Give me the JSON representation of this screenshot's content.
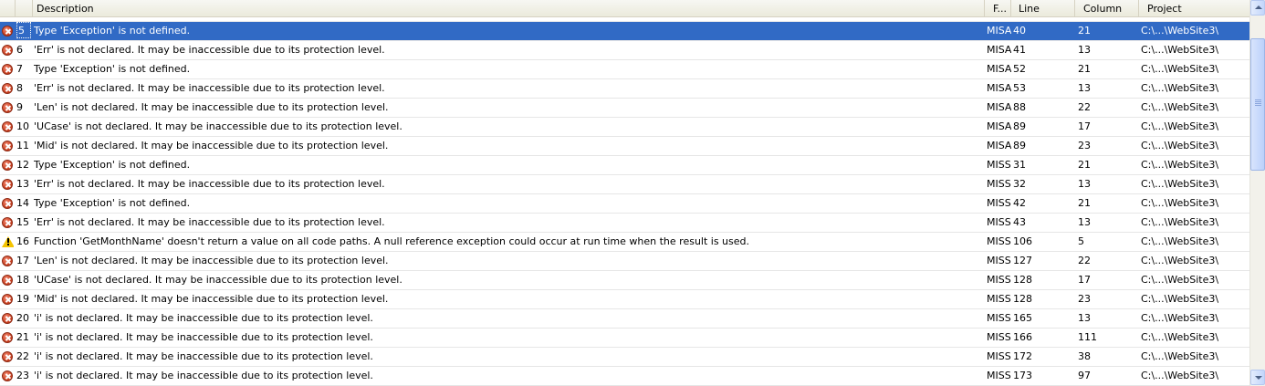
{
  "columns": {
    "description": "Description",
    "file": "F...",
    "line": "Line",
    "column": "Column",
    "project": "Project"
  },
  "rows": [
    {
      "type": "error",
      "num": "5",
      "desc": "Type 'Exception' is not defined.",
      "file": "MISA",
      "line": "40",
      "col": "21",
      "project": "C:\\...\\WebSite3\\",
      "selected": true
    },
    {
      "type": "error",
      "num": "6",
      "desc": "'Err' is not declared. It may be inaccessible due to its protection level.",
      "file": "MISA",
      "line": "41",
      "col": "13",
      "project": "C:\\...\\WebSite3\\"
    },
    {
      "type": "error",
      "num": "7",
      "desc": "Type 'Exception' is not defined.",
      "file": "MISA",
      "line": "52",
      "col": "21",
      "project": "C:\\...\\WebSite3\\"
    },
    {
      "type": "error",
      "num": "8",
      "desc": "'Err' is not declared. It may be inaccessible due to its protection level.",
      "file": "MISA",
      "line": "53",
      "col": "13",
      "project": "C:\\...\\WebSite3\\"
    },
    {
      "type": "error",
      "num": "9",
      "desc": "'Len' is not declared. It may be inaccessible due to its protection level.",
      "file": "MISA",
      "line": "88",
      "col": "22",
      "project": "C:\\...\\WebSite3\\"
    },
    {
      "type": "error",
      "num": "10",
      "desc": "'UCase' is not declared. It may be inaccessible due to its protection level.",
      "file": "MISA",
      "line": "89",
      "col": "17",
      "project": "C:\\...\\WebSite3\\"
    },
    {
      "type": "error",
      "num": "11",
      "desc": "'Mid' is not declared. It may be inaccessible due to its protection level.",
      "file": "MISA",
      "line": "89",
      "col": "23",
      "project": "C:\\...\\WebSite3\\"
    },
    {
      "type": "error",
      "num": "12",
      "desc": "Type 'Exception' is not defined.",
      "file": "MISS",
      "line": "31",
      "col": "21",
      "project": "C:\\...\\WebSite3\\"
    },
    {
      "type": "error",
      "num": "13",
      "desc": "'Err' is not declared. It may be inaccessible due to its protection level.",
      "file": "MISS",
      "line": "32",
      "col": "13",
      "project": "C:\\...\\WebSite3\\"
    },
    {
      "type": "error",
      "num": "14",
      "desc": "Type 'Exception' is not defined.",
      "file": "MISS",
      "line": "42",
      "col": "21",
      "project": "C:\\...\\WebSite3\\"
    },
    {
      "type": "error",
      "num": "15",
      "desc": "'Err' is not declared. It may be inaccessible due to its protection level.",
      "file": "MISS",
      "line": "43",
      "col": "13",
      "project": "C:\\...\\WebSite3\\"
    },
    {
      "type": "warning",
      "num": "16",
      "desc": "Function 'GetMonthName' doesn't return a value on all code paths. A null reference exception could occur at run time when the result is used.",
      "file": "MISS",
      "line": "106",
      "col": "5",
      "project": "C:\\...\\WebSite3\\"
    },
    {
      "type": "error",
      "num": "17",
      "desc": "'Len' is not declared. It may be inaccessible due to its protection level.",
      "file": "MISS",
      "line": "127",
      "col": "22",
      "project": "C:\\...\\WebSite3\\"
    },
    {
      "type": "error",
      "num": "18",
      "desc": "'UCase' is not declared. It may be inaccessible due to its protection level.",
      "file": "MISS",
      "line": "128",
      "col": "17",
      "project": "C:\\...\\WebSite3\\"
    },
    {
      "type": "error",
      "num": "19",
      "desc": "'Mid' is not declared. It may be inaccessible due to its protection level.",
      "file": "MISS",
      "line": "128",
      "col": "23",
      "project": "C:\\...\\WebSite3\\"
    },
    {
      "type": "error",
      "num": "20",
      "desc": "'i' is not declared. It may be inaccessible due to its protection level.",
      "file": "MISS",
      "line": "165",
      "col": "13",
      "project": "C:\\...\\WebSite3\\"
    },
    {
      "type": "error",
      "num": "21",
      "desc": "'i' is not declared. It may be inaccessible due to its protection level.",
      "file": "MISS",
      "line": "166",
      "col": "111",
      "project": "C:\\...\\WebSite3\\"
    },
    {
      "type": "error",
      "num": "22",
      "desc": "'i' is not declared. It may be inaccessible due to its protection level.",
      "file": "MISS",
      "line": "172",
      "col": "38",
      "project": "C:\\...\\WebSite3\\"
    },
    {
      "type": "error",
      "num": "23",
      "desc": "'i' is not declared. It may be inaccessible due to its protection level.",
      "file": "MISS",
      "line": "173",
      "col": "97",
      "project": "C:\\...\\WebSite3\\"
    }
  ],
  "icons": {
    "error": "error-icon",
    "warning": "warning-icon"
  },
  "colors": {
    "selection": "#316ac5",
    "error": "#c63a1a",
    "warning": "#f5c400"
  }
}
